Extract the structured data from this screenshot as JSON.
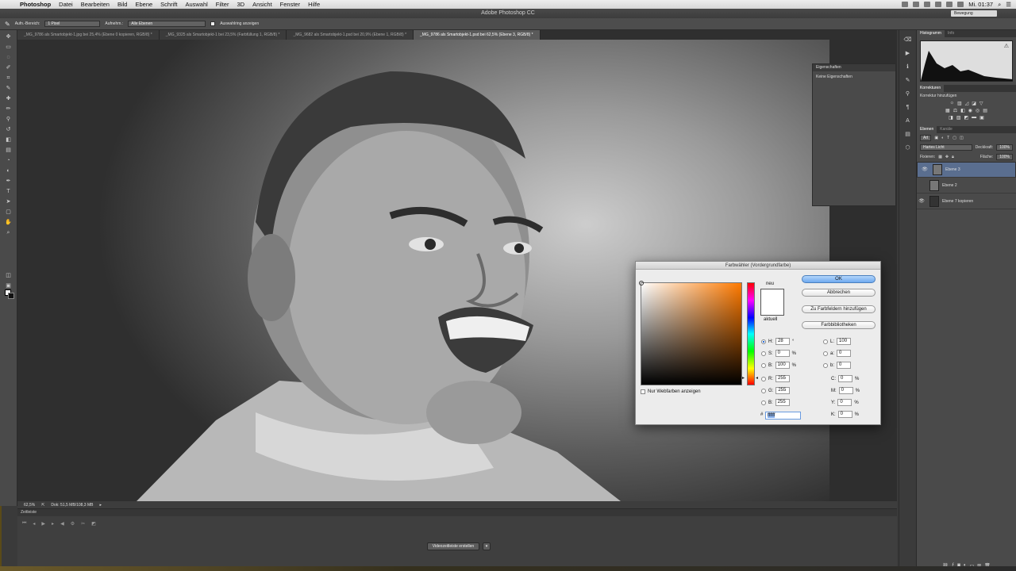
{
  "menubar": {
    "app": "Photoshop",
    "items": [
      "Datei",
      "Bearbeiten",
      "Bild",
      "Ebene",
      "Schrift",
      "Auswahl",
      "Filter",
      "3D",
      "Ansicht",
      "Fenster",
      "Hilfe"
    ],
    "clock": "Mi. 01:37"
  },
  "window": {
    "title": "Adobe Photoshop CC",
    "workspace": "Bewegung"
  },
  "options": {
    "sample_size_label": "Aufn.-Bereich:",
    "sample_size_value": "1 Pixel",
    "sample_label": "Aufnehm.:",
    "sample_value": "Alle Ebenen",
    "show_ring_label": "Auswahlring anzeigen"
  },
  "tabs": [
    "_MG_9786 als Smartobjekt-1.jpg bei 25,4% (Ebene 0 kopieren, RGB/8) *",
    "_MG_9325 als Smartobjekt-1 bei 23,5% (Farbfüllung 1, RGB/8) *",
    "_MG_9682 als Smartobjekt-1.psd bei 20,9% (Ebene 1, RGB/8) *",
    "_MG_9786 als Smartobjekt-1.psd bei 62,5% (Ebene 3, RGB/8) *"
  ],
  "status": {
    "zoom": "62,5%",
    "doc": "Dok: 51,5 MB/108,3 MB"
  },
  "timeline": {
    "title": "Zeitleiste",
    "create_button": "Videozeitleiste erstellen"
  },
  "properties": {
    "title": "Eigenschaften",
    "empty": "Keine Eigenschaften"
  },
  "histogram": {
    "tabs": [
      "Histogramm",
      "Info"
    ]
  },
  "corrections": {
    "tab": "Korrekturen",
    "add_label": "Korrektur hinzufügen"
  },
  "layers": {
    "tabs": [
      "Ebenen",
      "Kanäle"
    ],
    "filter": "Art",
    "blend_mode": "Hartes Licht",
    "opacity_label": "Deckkraft:",
    "opacity": "100%",
    "lock_label": "Fixieren:",
    "fill_label": "Fläche:",
    "fill": "100%",
    "items": [
      "Ebene 3",
      "Ebene 2",
      "Ebene 7 kopieren"
    ]
  },
  "picker": {
    "title": "Farbwähler (Vordergrundfarbe)",
    "new_label": "neu",
    "current_label": "aktuell",
    "ok": "OK",
    "cancel": "Abbrechen",
    "add_swatch": "Zu Farbfeldern hinzufügen",
    "libraries": "Farbbibliotheken",
    "web_only": "Nur Webfarben anzeigen",
    "hsb": {
      "h": "28",
      "s": "0",
      "b": "100"
    },
    "rgb": {
      "r": "255",
      "g": "255",
      "b": "255"
    },
    "lab": {
      "l": "100",
      "a": "0",
      "b": "0"
    },
    "cmyk": {
      "c": "0",
      "m": "0",
      "y": "0",
      "k": "0"
    },
    "hex": "ffffff",
    "deg": "°",
    "pct": "%"
  },
  "colors": {
    "foreground": "#ffffff",
    "background": "#111111",
    "accent": "#6ea9ef"
  }
}
